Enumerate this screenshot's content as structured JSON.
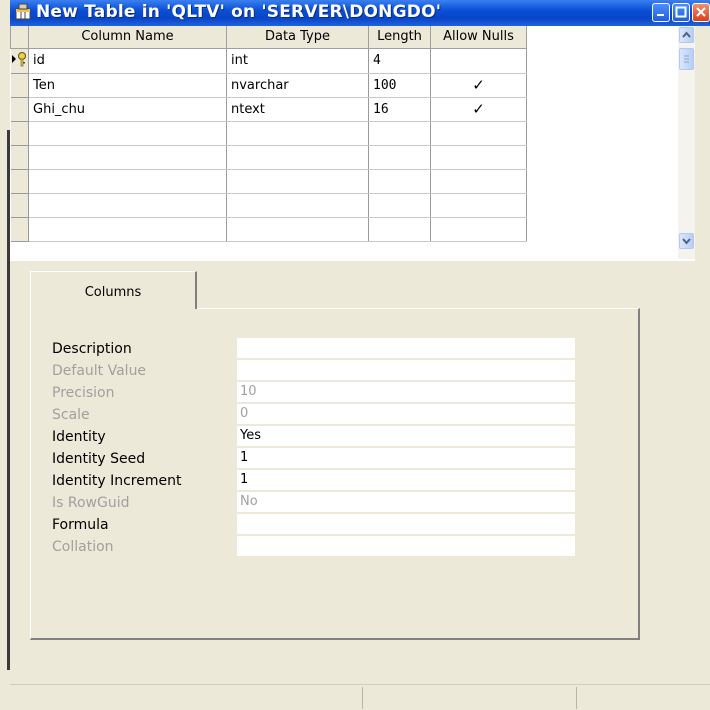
{
  "window": {
    "title": "New Table in 'QLTV' on 'SERVER\\DONGDO'",
    "app_icon": "table-icon",
    "buttons": [
      "minimize-icon",
      "maximize-icon",
      "close-icon"
    ]
  },
  "grid": {
    "headers": [
      "Column Name",
      "Data Type",
      "Length",
      "Allow Nulls"
    ],
    "rows": [
      {
        "name": "id",
        "type": "int",
        "length": "4",
        "allow_nulls": "",
        "key": true
      },
      {
        "name": "Ten",
        "type": "nvarchar",
        "length": "100",
        "allow_nulls": "✓"
      },
      {
        "name": "Ghi_chu",
        "type": "ntext",
        "length": "16",
        "allow_nulls": "✓"
      }
    ]
  },
  "tabs": {
    "columns": "Columns"
  },
  "properties": [
    {
      "label": "Description",
      "value": "",
      "enabled": true
    },
    {
      "label": "Default Value",
      "value": "",
      "enabled": false
    },
    {
      "label": "Precision",
      "value": "10",
      "enabled": false
    },
    {
      "label": "Scale",
      "value": "0",
      "enabled": false
    },
    {
      "label": "Identity",
      "value": "Yes",
      "enabled": true
    },
    {
      "label": "Identity Seed",
      "value": "1",
      "enabled": true
    },
    {
      "label": "Identity Increment",
      "value": "1",
      "enabled": true
    },
    {
      "label": "Is RowGuid",
      "value": "No",
      "enabled": false
    },
    {
      "label": "Formula",
      "value": "",
      "enabled": true
    },
    {
      "label": "Collation",
      "value": "",
      "enabled": false
    }
  ],
  "colors": {
    "titlebar": "#0a4fd6",
    "face": "#ece9d8",
    "disabled_text": "#a0a0a0"
  }
}
